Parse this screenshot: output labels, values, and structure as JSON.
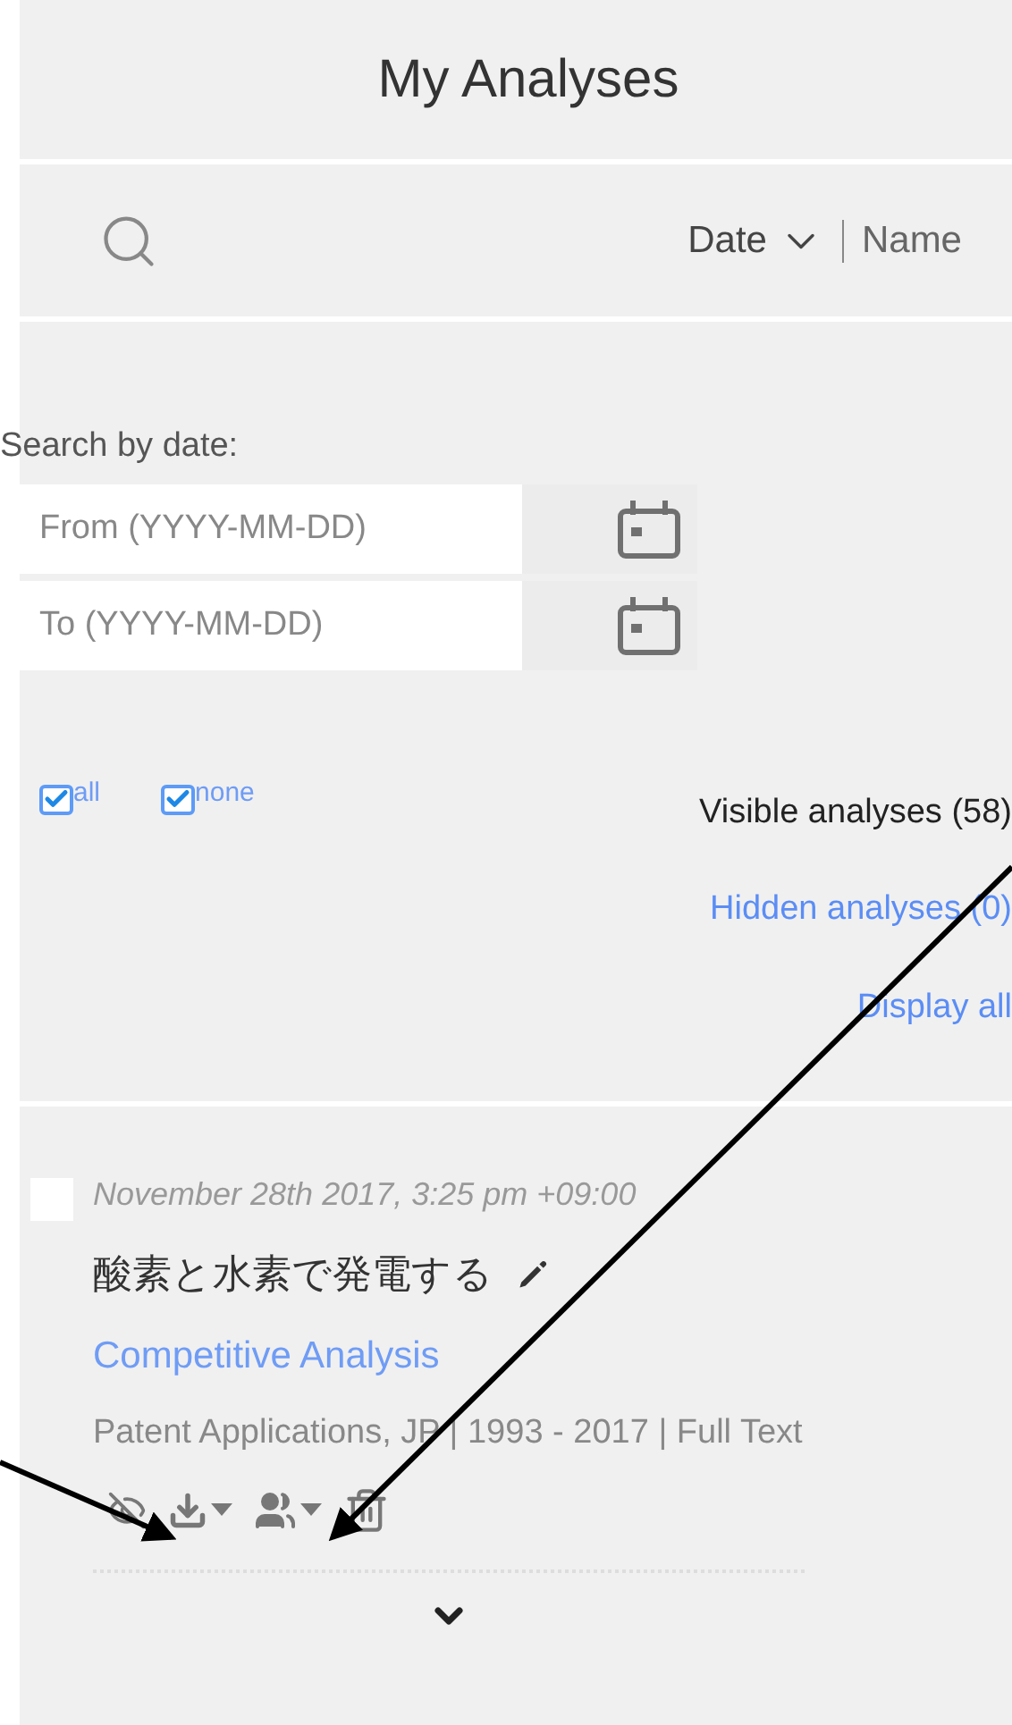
{
  "title": "My Analyses",
  "sort_options": [
    {
      "label": "Date",
      "selected": true
    },
    {
      "label": "Name",
      "selected": false
    }
  ],
  "date_search": {
    "label": "Search by date:",
    "from": {
      "placeholder": "From (YYYY-MM-DD)"
    },
    "to": {
      "placeholder": "To (YYYY-MM-DD)"
    }
  },
  "select_toggles": [
    {
      "label": "all",
      "checked": true
    },
    {
      "label": "none",
      "checked": true
    }
  ],
  "visibility_links": [
    {
      "label": "Visible analyses (58)",
      "selected": true
    },
    {
      "label": "Hidden analyses (0)",
      "selected": false
    },
    {
      "label": "Display all",
      "selected": false
    }
  ],
  "analyses": [
    {
      "checked": false,
      "date": "November 28th 2017, 3:25 pm +09:00",
      "title": "酸素と水素で発電する",
      "type": "Competitive Analysis",
      "description": "Patent Applications, JP | 1993 - 2017 | Full Text"
    }
  ]
}
